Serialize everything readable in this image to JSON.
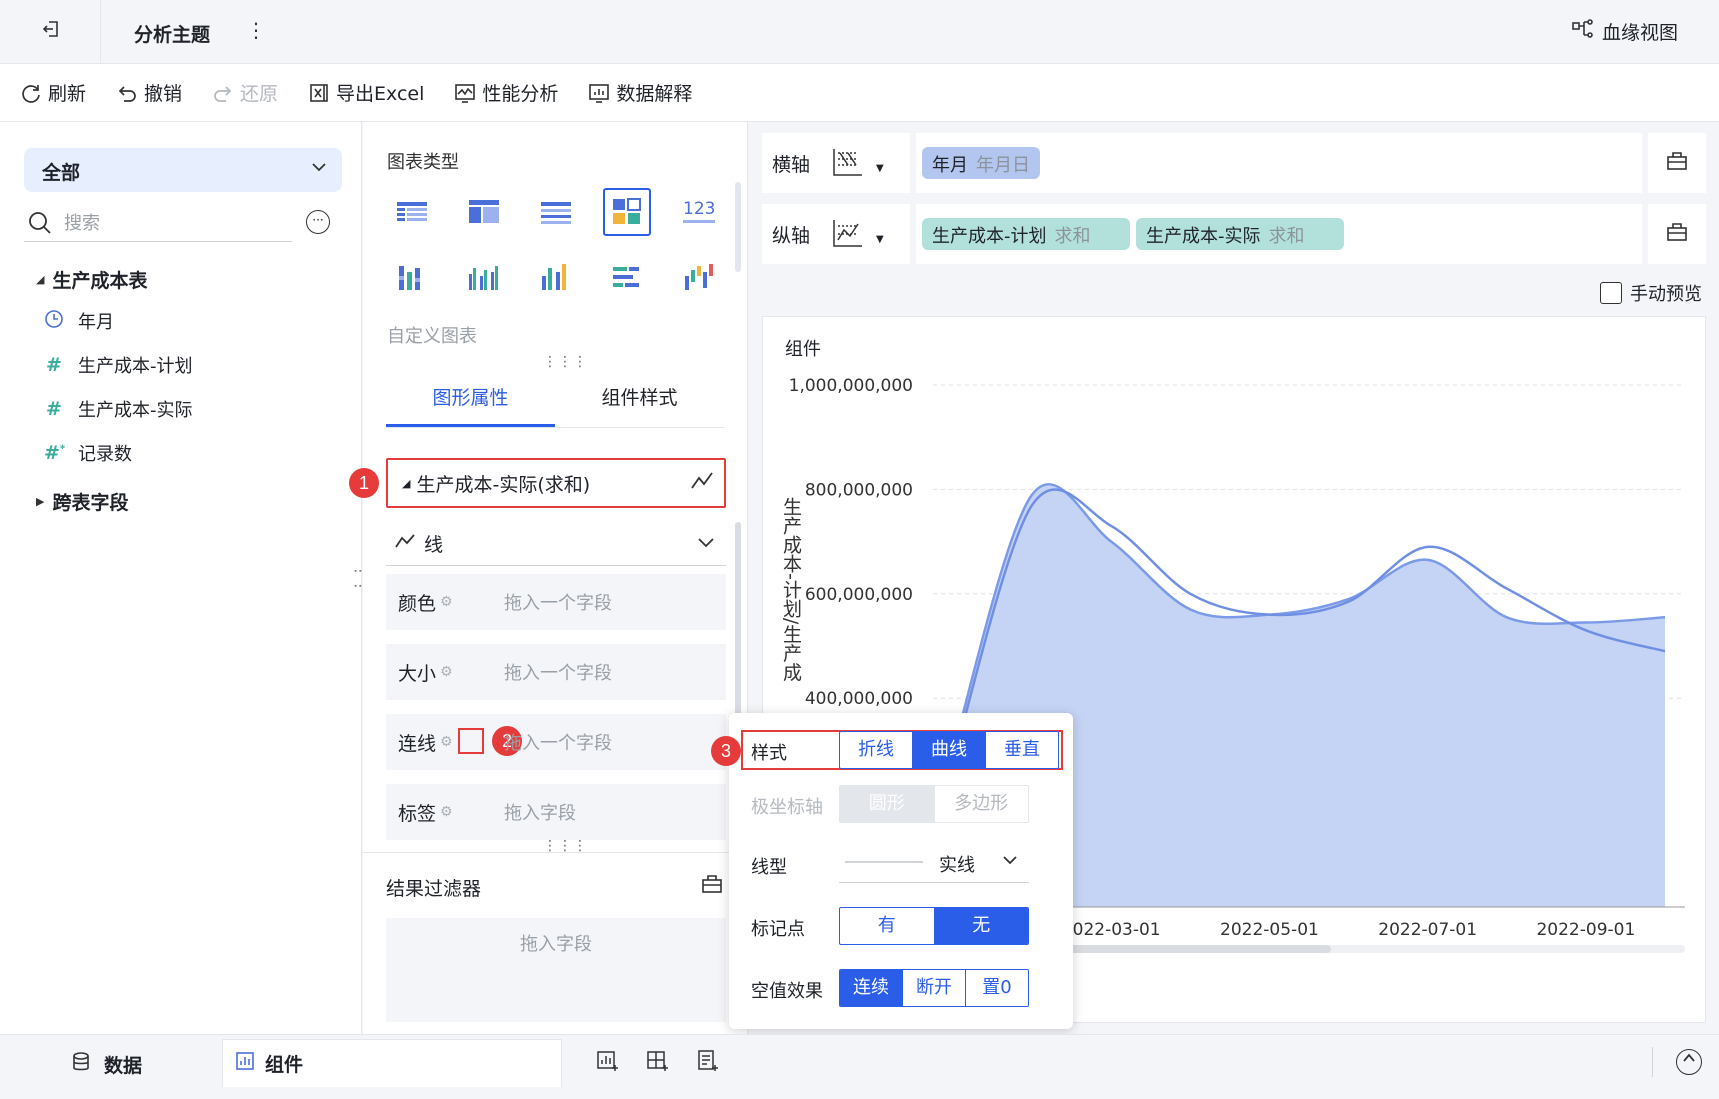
{
  "app": {
    "title": "分析主题",
    "lineage_label": "血缘视图"
  },
  "toolbar": {
    "refresh": "刷新",
    "undo": "撤销",
    "redo": "还原",
    "export": "导出Excel",
    "perf": "性能分析",
    "explain": "数据解释"
  },
  "left": {
    "scope": "全部",
    "search_placeholder": "搜索",
    "table_name": "生产成本表",
    "fields": [
      "年月",
      "生产成本-计划",
      "生产成本-实际",
      "记录数"
    ],
    "cross_table": "跨表字段"
  },
  "mid": {
    "chart_type_label": "图表类型",
    "custom_chart": "自定义图表",
    "tabs": [
      "图形属性",
      "组件样式"
    ],
    "series_name": "生产成本-实际(求和)",
    "mark_type": "线",
    "props": [
      {
        "label": "颜色",
        "placeholder": "拖入一个字段"
      },
      {
        "label": "大小",
        "placeholder": "拖入一个字段"
      },
      {
        "label": "连线",
        "placeholder": "拖入一个字段"
      },
      {
        "label": "标签",
        "placeholder": "拖入字段"
      }
    ],
    "filter_title": "结果过滤器",
    "filter_placeholder": "拖入字段",
    "badges": [
      "1",
      "2",
      "3"
    ]
  },
  "axes": {
    "x_label": "横轴",
    "y_label": "纵轴",
    "x_pill": {
      "name": "年月",
      "agg": "年月日"
    },
    "y_pills": [
      {
        "name": "生产成本-计划",
        "agg": "求和"
      },
      {
        "name": "生产成本-实际",
        "agg": "求和"
      }
    ],
    "manual_preview": "手动预览"
  },
  "chart": {
    "title": "组件"
  },
  "chart_data": {
    "type": "area",
    "ylabel": "生产成本-计划/生产成",
    "y_ticks": [
      "1,000,000,000",
      "800,000,000",
      "600,000,000",
      "400,000,000"
    ],
    "x_ticks": [
      "2022-03-01",
      "2022-05-01",
      "2022-07-01",
      "2022-09-01"
    ],
    "ylim": [
      0,
      1000000000
    ],
    "x": [
      "2022-01-01",
      "2022-02-01",
      "2022-03-01",
      "2022-04-01",
      "2022-05-01",
      "2022-06-01",
      "2022-07-01",
      "2022-08-01",
      "2022-09-01",
      "2022-10-01"
    ],
    "series": [
      {
        "name": "生产成本-计划",
        "values": [
          300000000,
          790000000,
          700000000,
          570000000,
          560000000,
          590000000,
          665000000,
          555000000,
          545000000,
          555000000
        ]
      },
      {
        "name": "生产成本-实际",
        "values": [
          280000000,
          770000000,
          730000000,
          600000000,
          560000000,
          585000000,
          690000000,
          610000000,
          530000000,
          490000000
        ]
      }
    ],
    "colors": [
      "#7b9be8",
      "#6f8fe3"
    ]
  },
  "popup": {
    "style_label": "样式",
    "style_options": [
      "折线",
      "曲线",
      "垂直"
    ],
    "style_selected": "曲线",
    "polar_label": "极坐标轴",
    "polar_options": [
      "圆形",
      "多边形"
    ],
    "polar_selected": "圆形",
    "linetype_label": "线型",
    "linetype_value": "实线",
    "marker_label": "标记点",
    "marker_options": [
      "有",
      "无"
    ],
    "marker_selected": "无",
    "null_label": "空值效果",
    "null_options": [
      "连续",
      "断开",
      "置0"
    ],
    "null_selected": "连续"
  },
  "bottom": {
    "data_tab": "数据",
    "component_tab": "组件"
  },
  "colors": {
    "accent": "#2b5ee8",
    "highlight": "#e63b3b",
    "area_fill": "#c5d3f5"
  }
}
